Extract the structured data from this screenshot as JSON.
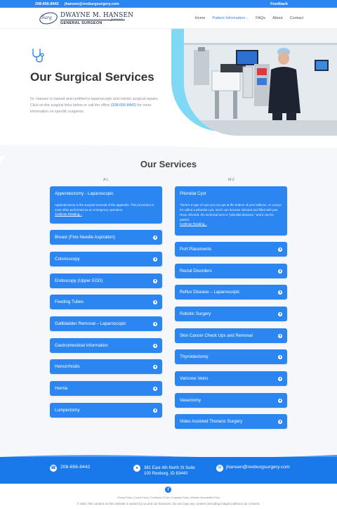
{
  "topbar": {
    "phone": "208-656-8442",
    "email": "jhansen@rexburgsurgery.com",
    "feedback": "Feedback"
  },
  "logo": {
    "mark": "Surg",
    "name": "DWAYNE M. HANSEN",
    "subtitle": "GENERAL SURGEON",
    "signature": "Jansen"
  },
  "nav": {
    "items": [
      {
        "label": "Home"
      },
      {
        "label": "Patient Information",
        "active": true,
        "has_dropdown": true
      },
      {
        "label": "FAQs"
      },
      {
        "label": "About"
      },
      {
        "label": "Contact"
      }
    ]
  },
  "hero": {
    "icon": "stethoscope-icon",
    "title": "Our Surgical Services",
    "text_before": "Dr. Hansen is trained and certified in laparoscopic and robotic surgical repairs. Click on the surgical links below or call the office ",
    "phone": "(208-656-8442)",
    "text_after": " for more information on specific surgeries."
  },
  "services": {
    "title": "Our Services",
    "col_left_label": "A-L",
    "col_right_label": "M-Z",
    "left_open": {
      "title": "Appendectomy - Laparoscopic",
      "body": "Appendectomy is the surgical removal of the appendix. This procedure is most often performed as an emergency operation.",
      "more": "Continue Reading..."
    },
    "left": [
      "Breast (Fine Needle Aspiration)",
      "Colonoscopy",
      "Endoscopy (Upper EGD)",
      "Feeding Tubes",
      "Gallbladder Removal – Laparoscopic",
      "Gastrointestinal Information",
      "Hemorrhoids",
      "Hernia",
      "Lumpectomy"
    ],
    "right_open": {
      "title": "Pilonidal Cyst",
      "body": "There's a type of cyst you can get at the bottom of your tailbone, or coccyx. It's called a pilonidal cyst, and it can become infected and filled with pus. Once infected, the technical term is \"pilonidal abscess,\" and it can be painful.",
      "more": "Continue Reading..."
    },
    "right": [
      "Port Placements",
      "Rectal Disorders",
      "Reflux Disease – Laparoscopic",
      "Robotic Surgery",
      "Skin Cancer Check Ups and Removal",
      "Thyroidectomy",
      "Varicose Veins",
      "Vasectomy",
      "Video Assisted Thoracic Surgery"
    ]
  },
  "footer": {
    "phone": "208-656-8442",
    "address_line1": "381 East 4th North St Suite",
    "address_line2": "100 Rexburg, ID 83440",
    "email": "jhansen@rexburgsurgery.com",
    "facebook": "f",
    "legal": "Privacy Policy  |  Cookie Policy  |  Conditions Of Use  |  Copyright Policy  |  Website Accessibility Policy",
    "copyright": "© 2021 The content on this website is owned by us and our licensors. Do not copy any content (including images) without our consent."
  },
  "colors": {
    "brand_blue": "#2b86f2",
    "footer_blue": "#1a79ea",
    "accent_cyan": "#7fd9f5"
  }
}
